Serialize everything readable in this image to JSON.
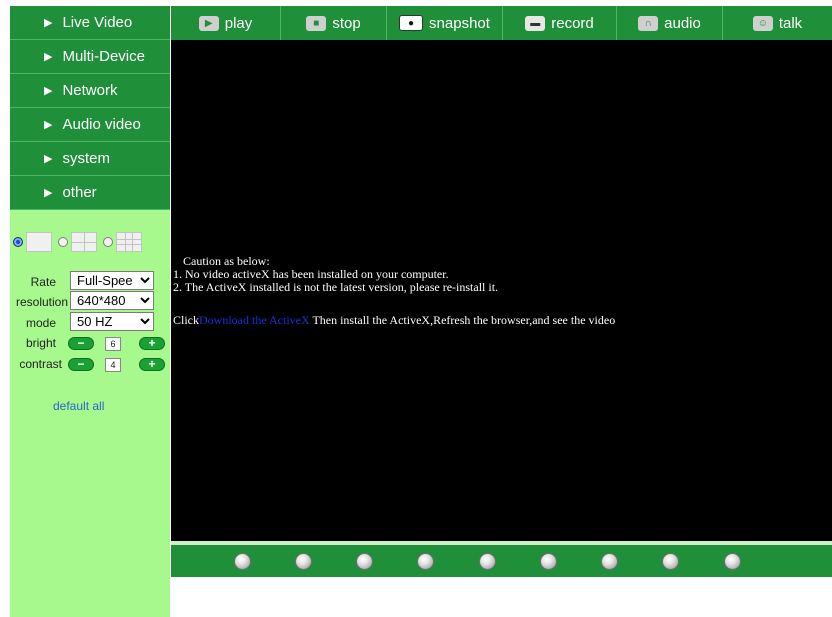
{
  "sidebar": {
    "menu": [
      "Live Video",
      "Multi-Device",
      "Network",
      "Audio video",
      "system",
      "other"
    ],
    "controls": {
      "rate_label": "Rate",
      "rate_value": "Full-Spee",
      "resolution_label": "resolution",
      "resolution_value": "640*480",
      "mode_label": "mode",
      "mode_value": "50 HZ",
      "bright_label": "bright",
      "bright_value": "6",
      "contrast_label": "contrast",
      "contrast_value": "4",
      "minus_symbol": "−",
      "plus_symbol": "+"
    },
    "default_all": "default all"
  },
  "toolbar": {
    "play": "play",
    "stop": "stop",
    "snapshot": "snapshot",
    "record": "record",
    "audio": "audio",
    "talk": "talk"
  },
  "video": {
    "caution_title": "Caution as below:",
    "line1": "1. No video activeX has been installed on your computer.",
    "line2": "2. The ActiveX installed is not the latest version, please re-install it.",
    "click": "Click",
    "download_link": "Download the ActiveX",
    "then_text": " Then install the ActiveX,Refresh the browser,and see the video"
  },
  "colors": {
    "menu_green": "#1f8f3a",
    "sidebar_bg": "#a7f98d",
    "video_bg": "#000000",
    "link_blue": "#1b2fe0"
  },
  "icons": [
    "play-icon",
    "stop-icon",
    "camera-icon",
    "record-icon",
    "headphone-icon",
    "talk-icon"
  ]
}
